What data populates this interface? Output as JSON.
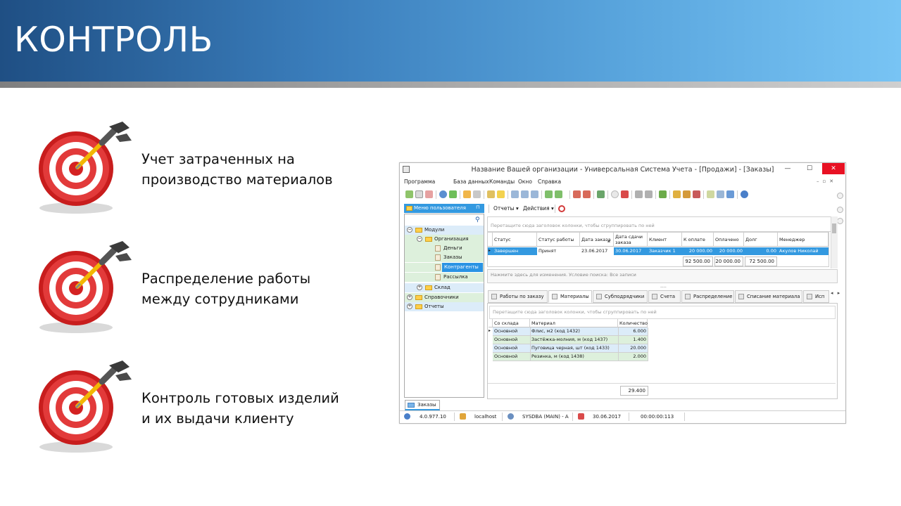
{
  "slide": {
    "title": "КОНТРОЛЬ",
    "bullets": [
      {
        "line1": "Учет затраченных на",
        "line2": "производство материалов"
      },
      {
        "line1": "Распределение работы",
        "line2": "между сотрудниками"
      },
      {
        "line1": "Контроль готовых изделий",
        "line2": "и их выдачи клиенту"
      }
    ]
  },
  "app": {
    "window_title": "Название Вашей организации - Универсальная Система Учета - [Продажи] - [Заказы]",
    "window_buttons": {
      "min": "—",
      "max": "☐",
      "close": "✕"
    },
    "menu": [
      "Программа",
      "База данных",
      "Команды",
      "Окно",
      "Справка"
    ],
    "mdi_controls": "–▫✕",
    "left_panel": {
      "header": "Меню пользователя",
      "pin": "⊓",
      "tree": [
        {
          "label": "Модули"
        },
        {
          "label": "Организация"
        },
        {
          "label": "Деньги"
        },
        {
          "label": "Заказы"
        },
        {
          "label": "Контрагенты"
        },
        {
          "label": "Рассылка"
        },
        {
          "label": "Склад"
        },
        {
          "label": "Справочники"
        },
        {
          "label": "Отчеты"
        }
      ],
      "bottom_tab": "Заказы"
    },
    "sub_toolbar": {
      "reports": "Отчеты ▾",
      "actions": "Действия ▾"
    },
    "group_hint": "Перетащите сюда заголовок колонки, чтобы сгруппировать по ней",
    "orders_grid": {
      "columns": [
        "Статус",
        "Статус работы",
        "Дата заказа",
        "Дата сдачи заказа",
        "Клиент",
        "К оплате",
        "Оплачено",
        "Долг",
        "Менеджер"
      ],
      "rows": [
        [
          "Завершен",
          "Принят",
          "23.06.2017",
          "30.06.2017",
          "Заказчик 1",
          "20 000.00",
          "20 000.00",
          "0.00",
          "Акулов Николай"
        ]
      ],
      "totals": {
        "to_pay": "92 500.00",
        "paid": "20 000.00",
        "debt": "72 500.00"
      }
    },
    "filter_text": "Нажмите здесь для изменения. Условие поиска: Все записи",
    "splitter": "----",
    "detail_tabs": [
      "Работы по заказу",
      "Материалы",
      "Субподрядчики",
      "Счета",
      "Распределение",
      "Списание материала",
      "Исп"
    ],
    "tab_nav": "◂ ▸",
    "materials_grid": {
      "columns": [
        "Со склада",
        "Материал",
        "Количество"
      ],
      "rows": [
        [
          "Основной",
          "Флис, м2 (код 1432)",
          "6.000"
        ],
        [
          "Основной",
          "Застёжка-молния, м (код 1437)",
          "1.400"
        ],
        [
          "Основной",
          "Пуговица черная, шт (код 1433)",
          "20.000"
        ],
        [
          "Основной",
          "Резинка, м (код 1438)",
          "2.000"
        ]
      ],
      "total": "29.400"
    },
    "statusbar": {
      "version": "4.0.977.10",
      "host": "localhost",
      "user": "SYSDBA (MAIN) - A",
      "date": "30.06.2017",
      "timer": "00:00:00:113"
    }
  }
}
